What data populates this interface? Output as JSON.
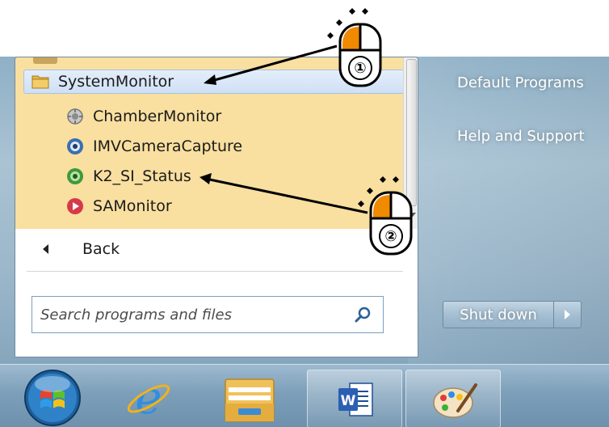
{
  "programs": {
    "folder_label": "SystemMonitor",
    "items": [
      {
        "label": "ChamberMonitor",
        "icon": "chamber-monitor-icon"
      },
      {
        "label": "IMVCameraCapture",
        "icon": "camera-capture-icon"
      },
      {
        "label": "K2_SI_Status",
        "icon": "k2-status-icon"
      },
      {
        "label": "SAMonitor",
        "icon": "sa-monitor-icon"
      }
    ]
  },
  "back_label": "Back",
  "search": {
    "placeholder": "Search programs and files",
    "value": ""
  },
  "right_pane": {
    "items": [
      "Default Programs",
      "Help and Support"
    ]
  },
  "shutdown_label": "Shut down",
  "taskbar": {
    "items": [
      "start-orb-icon",
      "internet-explorer-icon",
      "file-explorer-icon",
      "word-icon",
      "paint-icon"
    ]
  },
  "annotations": {
    "step1": "①",
    "step2": "②"
  },
  "colors": {
    "programs_highlight": "#f9dfa0",
    "folder_highlight": "#cfe0f5",
    "mouse_button": "#f08a00"
  }
}
